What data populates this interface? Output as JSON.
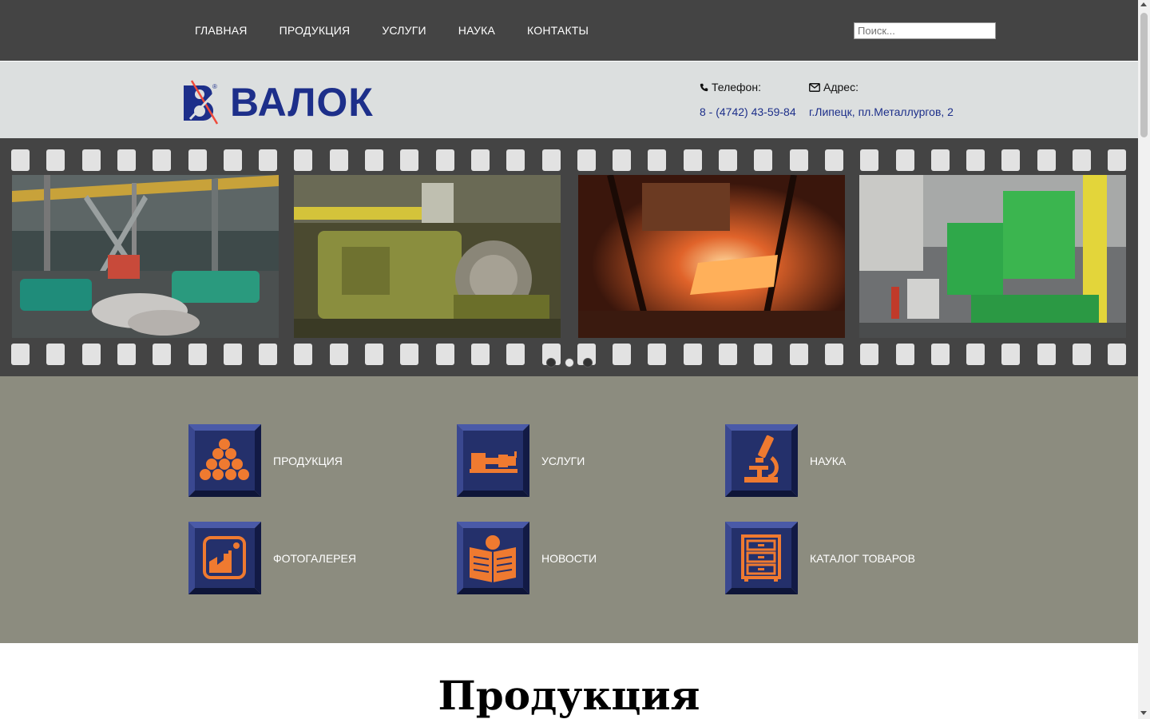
{
  "nav": {
    "items": [
      "ГЛАВНАЯ",
      "ПРОДУКЦИЯ",
      "УСЛУГИ",
      "НАУКА",
      "КОНТАКТЫ"
    ],
    "search_placeholder": "Поиск..."
  },
  "header": {
    "logo_text": "ВАЛОК",
    "phone_label": "Телефон:",
    "phone_value": "8 - (4742) 43-59-84",
    "address_label": "Адрес:",
    "address_value": "г.Липецк, пл.Металлургов, 2"
  },
  "slider": {
    "slides": [
      "workshop-hall",
      "rolling-machine",
      "hot-metal-furnace",
      "green-machinery"
    ],
    "active_dot": 1,
    "dot_count": 3
  },
  "tiles": [
    {
      "label": "ПРОДУКЦИЯ",
      "icon": "rolls-stack-icon"
    },
    {
      "label": "УСЛУГИ",
      "icon": "lathe-icon"
    },
    {
      "label": "НАУКА",
      "icon": "microscope-icon"
    },
    {
      "label": "ФОТОГАЛЕРЕЯ",
      "icon": "photo-gallery-icon"
    },
    {
      "label": "НОВОСТИ",
      "icon": "newspaper-icon"
    },
    {
      "label": "КАТАЛОГ ТОВАРОВ",
      "icon": "catalog-cabinet-icon"
    }
  ],
  "section_heading": "Продукция",
  "colors": {
    "nav_bg": "#444444",
    "header_bg": "#dcdfdf",
    "tiles_bg": "#8c8c7f",
    "tile_blue": "#24306b",
    "icon_orange": "#ef7a30",
    "brand_blue": "#1d2f8a"
  }
}
